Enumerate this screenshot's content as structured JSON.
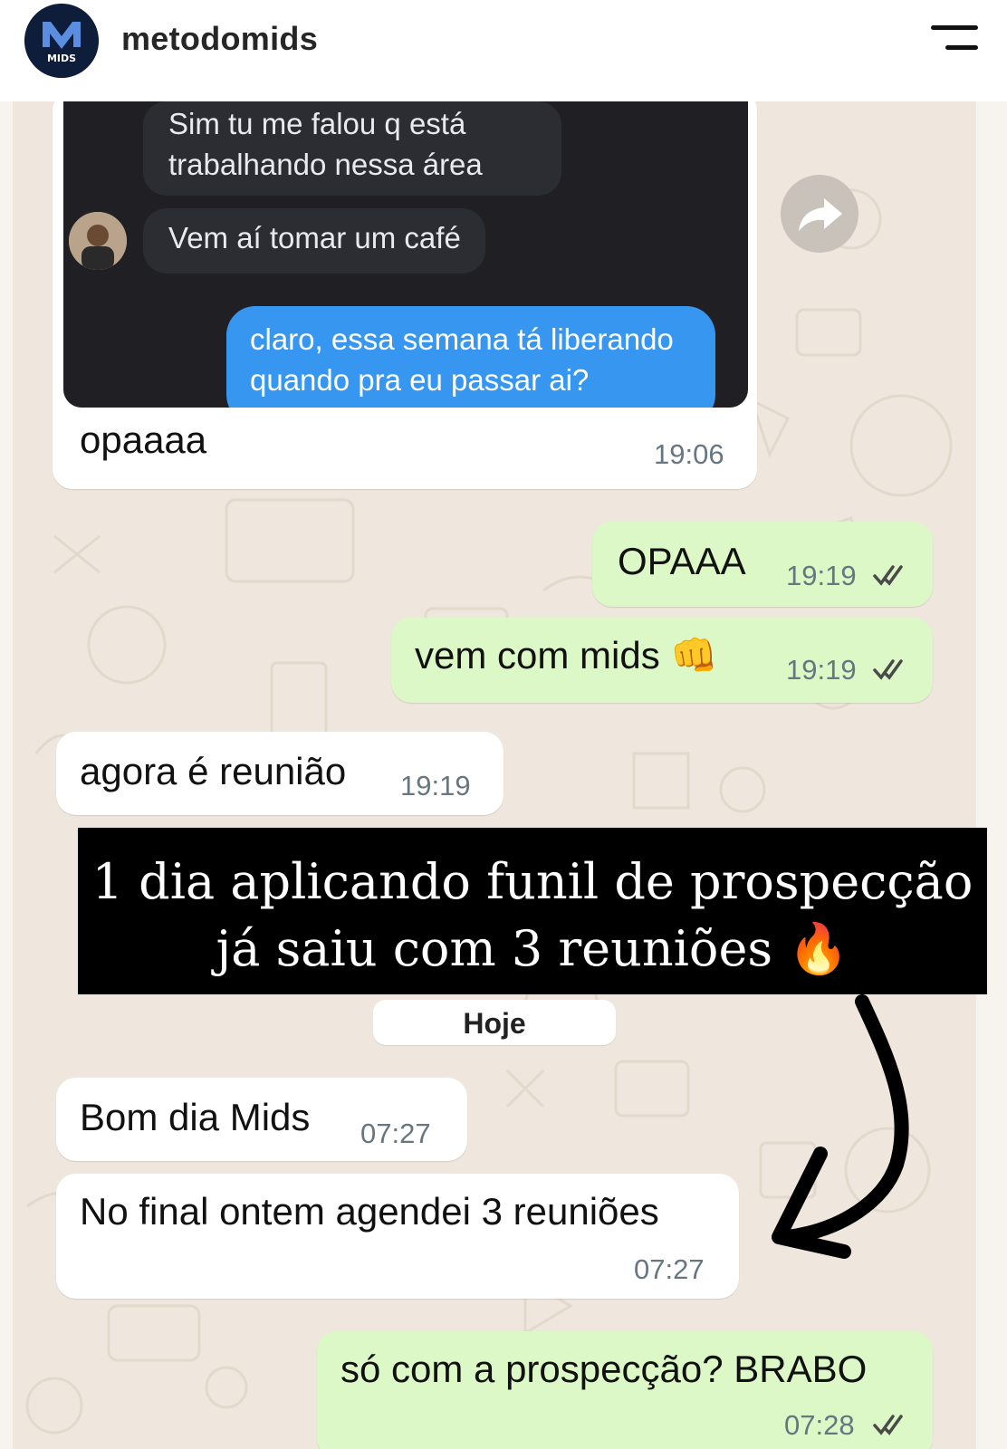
{
  "header": {
    "avatar_text_top": "M",
    "avatar_text_bottom": "MIDS",
    "username": "metodomids"
  },
  "embedded_screenshot": {
    "message_1_line_1": "Sim tu me falou q está",
    "message_1_line_2": "trabalhando nessa área",
    "message_2": "Vem aí tomar um café",
    "reply_line_1": "claro, essa semana tá liberando",
    "reply_line_2": "quando pra eu passar ai?"
  },
  "messages": [
    {
      "text": "opaaaa",
      "time": "19:06",
      "direction": "in"
    },
    {
      "text": "OPAAA",
      "time": "19:19",
      "direction": "out"
    },
    {
      "text": "vem com mids 👊",
      "time": "19:19",
      "direction": "out"
    },
    {
      "text": "agora é reunião",
      "time": "19:19",
      "direction": "in"
    },
    {
      "text": "Bom dia Mids",
      "time": "07:27",
      "direction": "in"
    },
    {
      "text": "No final ontem agendei 3 reuniões",
      "time": "07:27",
      "direction": "in"
    },
    {
      "text": "só com a prospecção? BRABO",
      "time": "07:28",
      "direction": "out"
    }
  ],
  "banner": {
    "line_1": "1 dia aplicando funil de prospecção",
    "line_2": "já saiu com 3 reuniões 🔥"
  },
  "date_separator": "Hoje",
  "colors": {
    "incoming_bubble": "#ffffff",
    "outgoing_bubble": "#dcf8c6",
    "chat_background": "#efe7dd",
    "read_ticks": "#4a4a4a",
    "embedded_reply": "#3797f0"
  },
  "icons": [
    "avatar-logo",
    "hamburger-menu-icon",
    "forward-icon",
    "double-check-icon",
    "arrow-annotation"
  ]
}
